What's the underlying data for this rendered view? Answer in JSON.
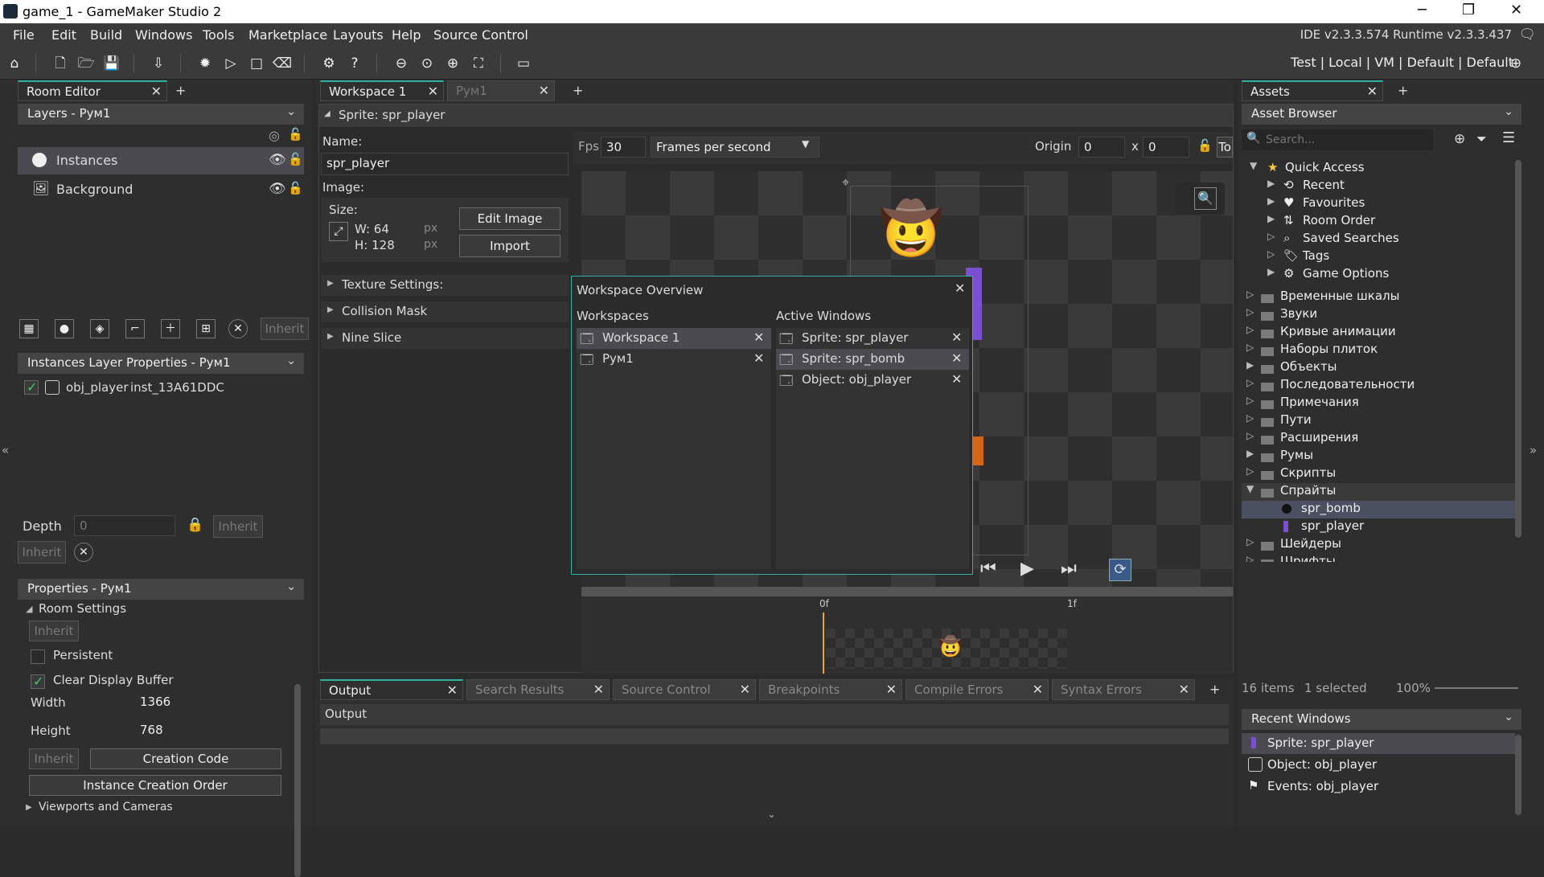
{
  "window": {
    "title": "game_1 - GameMaker Studio 2",
    "minimize": "─",
    "maximize": "❐",
    "close": "✕"
  },
  "menu": [
    "File",
    "Edit",
    "Build",
    "Windows",
    "Tools",
    "Marketplace",
    "Layouts",
    "Help",
    "Source Control"
  ],
  "ide_version": "IDE v2.3.3.574  Runtime v2.3.3.437",
  "target_config": "Test | Local | VM | Default | Default",
  "room_editor": {
    "tab": "Room Editor",
    "layers_header": "Layers - Рум1",
    "layers": [
      "Instances",
      "Background"
    ],
    "inherit_btn": "Inherit",
    "instances_header": "Instances Layer Properties - Рум1",
    "instance": {
      "object": "obj_player",
      "id": "inst_13A61DDC"
    },
    "depth_label": "Depth",
    "depth_value": "0",
    "inherit1": "Inherit",
    "inherit2": "Inherit",
    "properties_header": "Properties - Рум1",
    "room_settings": "Room Settings",
    "inherit3": "Inherit",
    "persistent": "Persistent",
    "clear_display": "Clear Display Buffer",
    "width_label": "Width",
    "width_value": "1366",
    "height_label": "Height",
    "height_value": "768",
    "inherit4": "Inherit",
    "creation_code": "Creation Code",
    "instance_order": "Instance Creation Order",
    "viewports": "Viewports and Cameras"
  },
  "workspace_tabs": [
    "Workspace 1",
    "Рум1"
  ],
  "sprite_editor": {
    "title": "Sprite: spr_player",
    "name_label": "Name:",
    "name_value": "spr_player",
    "image_label": "Image:",
    "size_label": "Size:",
    "w": "W: 64",
    "h": "H: 128",
    "px": "px",
    "edit_image": "Edit Image",
    "import": "Import",
    "sections": [
      "Texture Settings:",
      "Collision Mask",
      "Nine Slice"
    ],
    "fps_label": "Fps",
    "fps_value": "30",
    "fps_mode": "Frames per second",
    "origin_label": "Origin",
    "origin_x": "0",
    "origin_sep": "x",
    "origin_y": "0",
    "to_btn": "To",
    "frame0": "0f",
    "frame1": "1f"
  },
  "workspace_overview": {
    "title": "Workspace Overview",
    "workspaces_label": "Workspaces",
    "workspaces": [
      "Workspace 1",
      "Рум1"
    ],
    "active_label": "Active Windows",
    "active": [
      "Sprite: spr_player",
      "Sprite: spr_bomb",
      "Object: obj_player"
    ]
  },
  "output_tabs": [
    "Output",
    "Search Results",
    "Source Control",
    "Breakpoints",
    "Compile Errors",
    "Syntax Errors"
  ],
  "output_title": "Output",
  "assets": {
    "tab": "Assets",
    "browser": "Asset Browser",
    "search_placeholder": "Search...",
    "quick_access": "Quick Access",
    "quick_items": [
      "Recent",
      "Favourites",
      "Room Order",
      "Saved Searches",
      "Tags",
      "Game Options"
    ],
    "folders_top": [
      "Временные шкалы",
      "Звуки",
      "Кривые анимации",
      "Наборы плиток",
      "Объекты",
      "Последовательности",
      "Примечания",
      "Пути",
      "Расширения",
      "Румы",
      "Скрипты"
    ],
    "sprites_folder": "Спрайты",
    "sprites": [
      "spr_bomb",
      "spr_player"
    ],
    "folders_bottom": [
      "Шейдеры",
      "Шрифты"
    ],
    "status_items": "16 items",
    "status_selected": "1 selected",
    "zoom": "100%",
    "recent_header": "Recent Windows",
    "recent": [
      "Sprite: spr_player",
      "Object: obj_player",
      "Events: obj_player"
    ]
  },
  "colors": {
    "accent": "#2fb3a0",
    "bg": "#2b2b2b",
    "panel": "#333333",
    "highlight": "#4a5060"
  }
}
